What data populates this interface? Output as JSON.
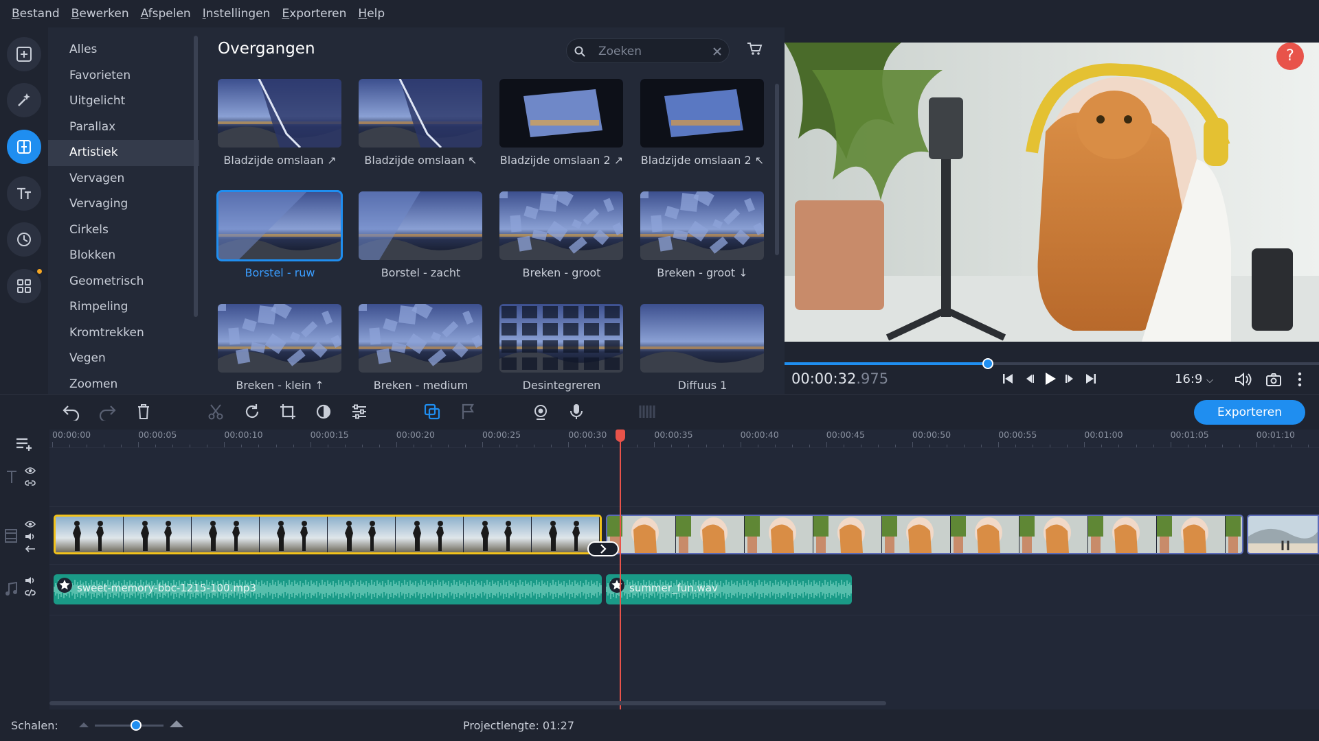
{
  "menu": [
    "Bestand",
    "Bewerken",
    "Afspelen",
    "Instellingen",
    "Exporteren",
    "Help"
  ],
  "categories": {
    "items": [
      "Alles",
      "Favorieten",
      "Uitgelicht",
      "Parallax",
      "Artistiek",
      "Vervagen",
      "Vervaging",
      "Cirkels",
      "Blokken",
      "Geometrisch",
      "Rimpeling",
      "Kromtrekken",
      "Vegen",
      "Zoomen"
    ],
    "active": "Artistiek"
  },
  "panel": {
    "title": "Overgangen",
    "search_placeholder": "Zoeken",
    "transitions": [
      "Bladzijde omslaan ↗",
      "Bladzijde omslaan ↖",
      "Bladzijde omslaan 2 ↗",
      "Bladzijde omslaan 2 ↖",
      "Borstel - ruw",
      "Borstel - zacht",
      "Breken - groot",
      "Breken - groot ↓",
      "Breken - klein ↑",
      "Breken - medium",
      "Desintegreren",
      "Diffuus 1"
    ],
    "selected": "Borstel - ruw"
  },
  "player": {
    "help_label": "?",
    "timecode_main": "00:00:32",
    "timecode_ms": ".975",
    "aspect_ratio": "16:9",
    "progress": 0.38
  },
  "toolbar": {
    "export_label": "Exporteren"
  },
  "timeline": {
    "ruler": [
      "00:00:00",
      "00:00:05",
      "00:00:10",
      "00:00:15",
      "00:00:20",
      "00:00:25",
      "00:00:30",
      "00:00:35",
      "00:00:40",
      "00:00:45",
      "00:00:50",
      "00:00:55",
      "00:01:00",
      "00:01:05",
      "00:01:10"
    ],
    "audio_clips": [
      {
        "name": "sweet-memory-bbc-1215-100.mp3"
      },
      {
        "name": "summer_fun.wav"
      }
    ]
  },
  "status": {
    "scale_label": "Schalen:",
    "project_length": "Projectlengte: 01:27"
  },
  "colors": {
    "accent": "#1f8ef0",
    "selection": "#f2c21b",
    "audio": "#1a9a87",
    "playhead": "#e8534a"
  }
}
